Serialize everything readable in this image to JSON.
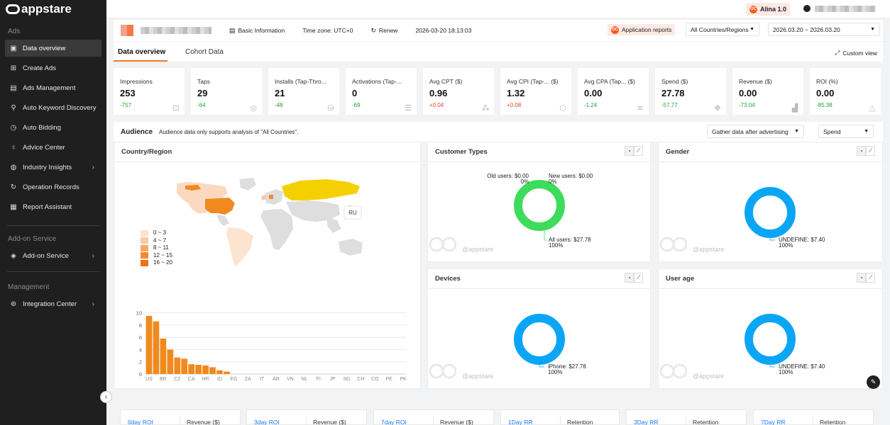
{
  "app": {
    "brand": "appstare"
  },
  "sidebar": {
    "sections": [
      "Ads",
      "Add-on Service",
      "Management"
    ],
    "items": [
      {
        "label": "Data overview",
        "icon": "chart-icon"
      },
      {
        "label": "Create Ads",
        "icon": "plus-square-icon"
      },
      {
        "label": "Ads Management",
        "icon": "ads-icon"
      },
      {
        "label": "Auto Keyword Discovery",
        "icon": "keyword-icon"
      },
      {
        "label": "Auto Bidding",
        "icon": "auto-icon"
      },
      {
        "label": "Advice Center",
        "icon": "bulb-icon"
      },
      {
        "label": "Industry Insights",
        "icon": "globe-icon"
      },
      {
        "label": "Operation Records",
        "icon": "history-icon"
      },
      {
        "label": "Report Assistant",
        "icon": "report-icon"
      },
      {
        "label": "Add-on Service",
        "icon": "diamond-icon"
      },
      {
        "label": "Integration Center",
        "icon": "integration-icon"
      }
    ]
  },
  "topbar": {
    "user_badge": "Alina 1.0",
    "oc": "OC"
  },
  "infobar": {
    "basic_info": "Basic Information",
    "timezone": "Time zone:  UTC+0",
    "renew": "Renew",
    "timestamp": "2026-03-20 18:13:03",
    "app_reports": "Application reports",
    "region": "All Countries/Regions",
    "date_range": "2026.03.20 ~ 2026.03.20"
  },
  "tabs": {
    "overview": "Data overview",
    "cohort": "Cohort Data",
    "custom_view": "Custom view"
  },
  "metrics": [
    {
      "label": "Impressions",
      "value": "253",
      "delta": "-757",
      "dir": "neg"
    },
    {
      "label": "Taps",
      "value": "29",
      "delta": "-64",
      "dir": "neg"
    },
    {
      "label": "Installs (Tap-Thro...",
      "value": "21",
      "delta": "-48",
      "dir": "neg"
    },
    {
      "label": "Activations (Tap-...",
      "value": "0",
      "delta": "-69",
      "dir": "neg"
    },
    {
      "label": "Avg CPT ($)",
      "value": "0.96",
      "delta": "+0.04",
      "dir": "pos"
    },
    {
      "label": "Avg CPI (Tap-...   ($)",
      "value": "1.32",
      "delta": "+0.08",
      "dir": "pos"
    },
    {
      "label": "Avg CPA (Tap...   ($)",
      "value": "0.00",
      "delta": "-1.24",
      "dir": "neg"
    },
    {
      "label": "Spend ($)",
      "value": "27.78",
      "delta": "-57.77",
      "dir": "neg"
    },
    {
      "label": "Revenue ($)",
      "value": "0.00",
      "delta": "-73.04",
      "dir": "neg"
    },
    {
      "label": "ROI (%)",
      "value": "0.00",
      "delta": "-85.38",
      "dir": "neg"
    }
  ],
  "audience": {
    "title": "Audience",
    "note": "Audience data only supports analysis of \"All Countries\".",
    "gather": "Gather data after advertising",
    "metric_select": "Spend"
  },
  "country": {
    "title": "Country/Region",
    "tooltip": "RU",
    "legend": [
      {
        "label": "0 ~ 3",
        "color": "#fde4d0"
      },
      {
        "label": "4 ~ 7",
        "color": "#fbc9a2"
      },
      {
        "label": "8 ~ 11",
        "color": "#f9a866"
      },
      {
        "label": "12 ~ 15",
        "color": "#f5892f"
      },
      {
        "label": "16 ~ 20",
        "color": "#ee7212"
      }
    ]
  },
  "chart_data": {
    "type": "bar",
    "categories": [
      "US",
      "",
      "BR",
      "",
      "CZ",
      "",
      "CA",
      "",
      "HR",
      "",
      "ID",
      "",
      "EG",
      "",
      "ZA",
      "",
      "IT",
      "",
      "AR",
      "",
      "VN",
      "",
      "NL",
      "",
      "FI",
      "",
      "JP",
      "",
      "SG",
      "",
      "CH",
      "",
      "CO",
      "",
      "PE",
      "",
      "PK"
    ],
    "values": [
      9.5,
      8.6,
      5.8,
      4,
      2.7,
      2.5,
      1.6,
      1.5,
      1.4,
      1.1,
      0.6,
      0.4,
      0,
      0,
      0,
      0,
      0,
      0,
      0,
      0,
      0,
      0,
      0,
      0,
      0,
      0,
      0,
      0,
      0,
      0,
      0,
      0,
      0,
      0,
      0,
      0,
      0
    ],
    "yticks": [
      0,
      2,
      4,
      6,
      8,
      10
    ],
    "ylim": [
      0,
      11
    ],
    "color": "#f08a1e"
  },
  "donuts": [
    {
      "title": "Customer Types",
      "color": "#3ddc5c",
      "labels": [
        {
          "name": "Old users: $0.00",
          "pct": "0%"
        },
        {
          "name": "New users: $0.00",
          "pct": "0%"
        },
        {
          "name": "All users: $27.78",
          "pct": "100%"
        }
      ]
    },
    {
      "title": "Gender",
      "color": "#0aa6f5",
      "labels": [
        {
          "name": "UNDEFINE: $7.40",
          "pct": "100%"
        }
      ]
    },
    {
      "title": "Devices",
      "color": "#0aa6f5",
      "labels": [
        {
          "name": "iPhone: $27.78",
          "pct": "100%"
        }
      ]
    },
    {
      "title": "User age",
      "color": "#0aa6f5",
      "labels": [
        {
          "name": "UNDEFINE: $7.40",
          "pct": "100%"
        }
      ]
    }
  ],
  "watermark": "@appstare",
  "bottom_cards": [
    {
      "left": "0day ROI",
      "right": "Revenue  ($)"
    },
    {
      "left": "3day ROI",
      "right": "Revenue  ($)"
    },
    {
      "left": "7day ROI",
      "right": "Revenue  ($)"
    },
    {
      "left": "1Day RR",
      "right": "Retention"
    },
    {
      "left": "3Day RR",
      "right": "Retention"
    },
    {
      "left": "7Day RR",
      "right": "Retention"
    }
  ]
}
